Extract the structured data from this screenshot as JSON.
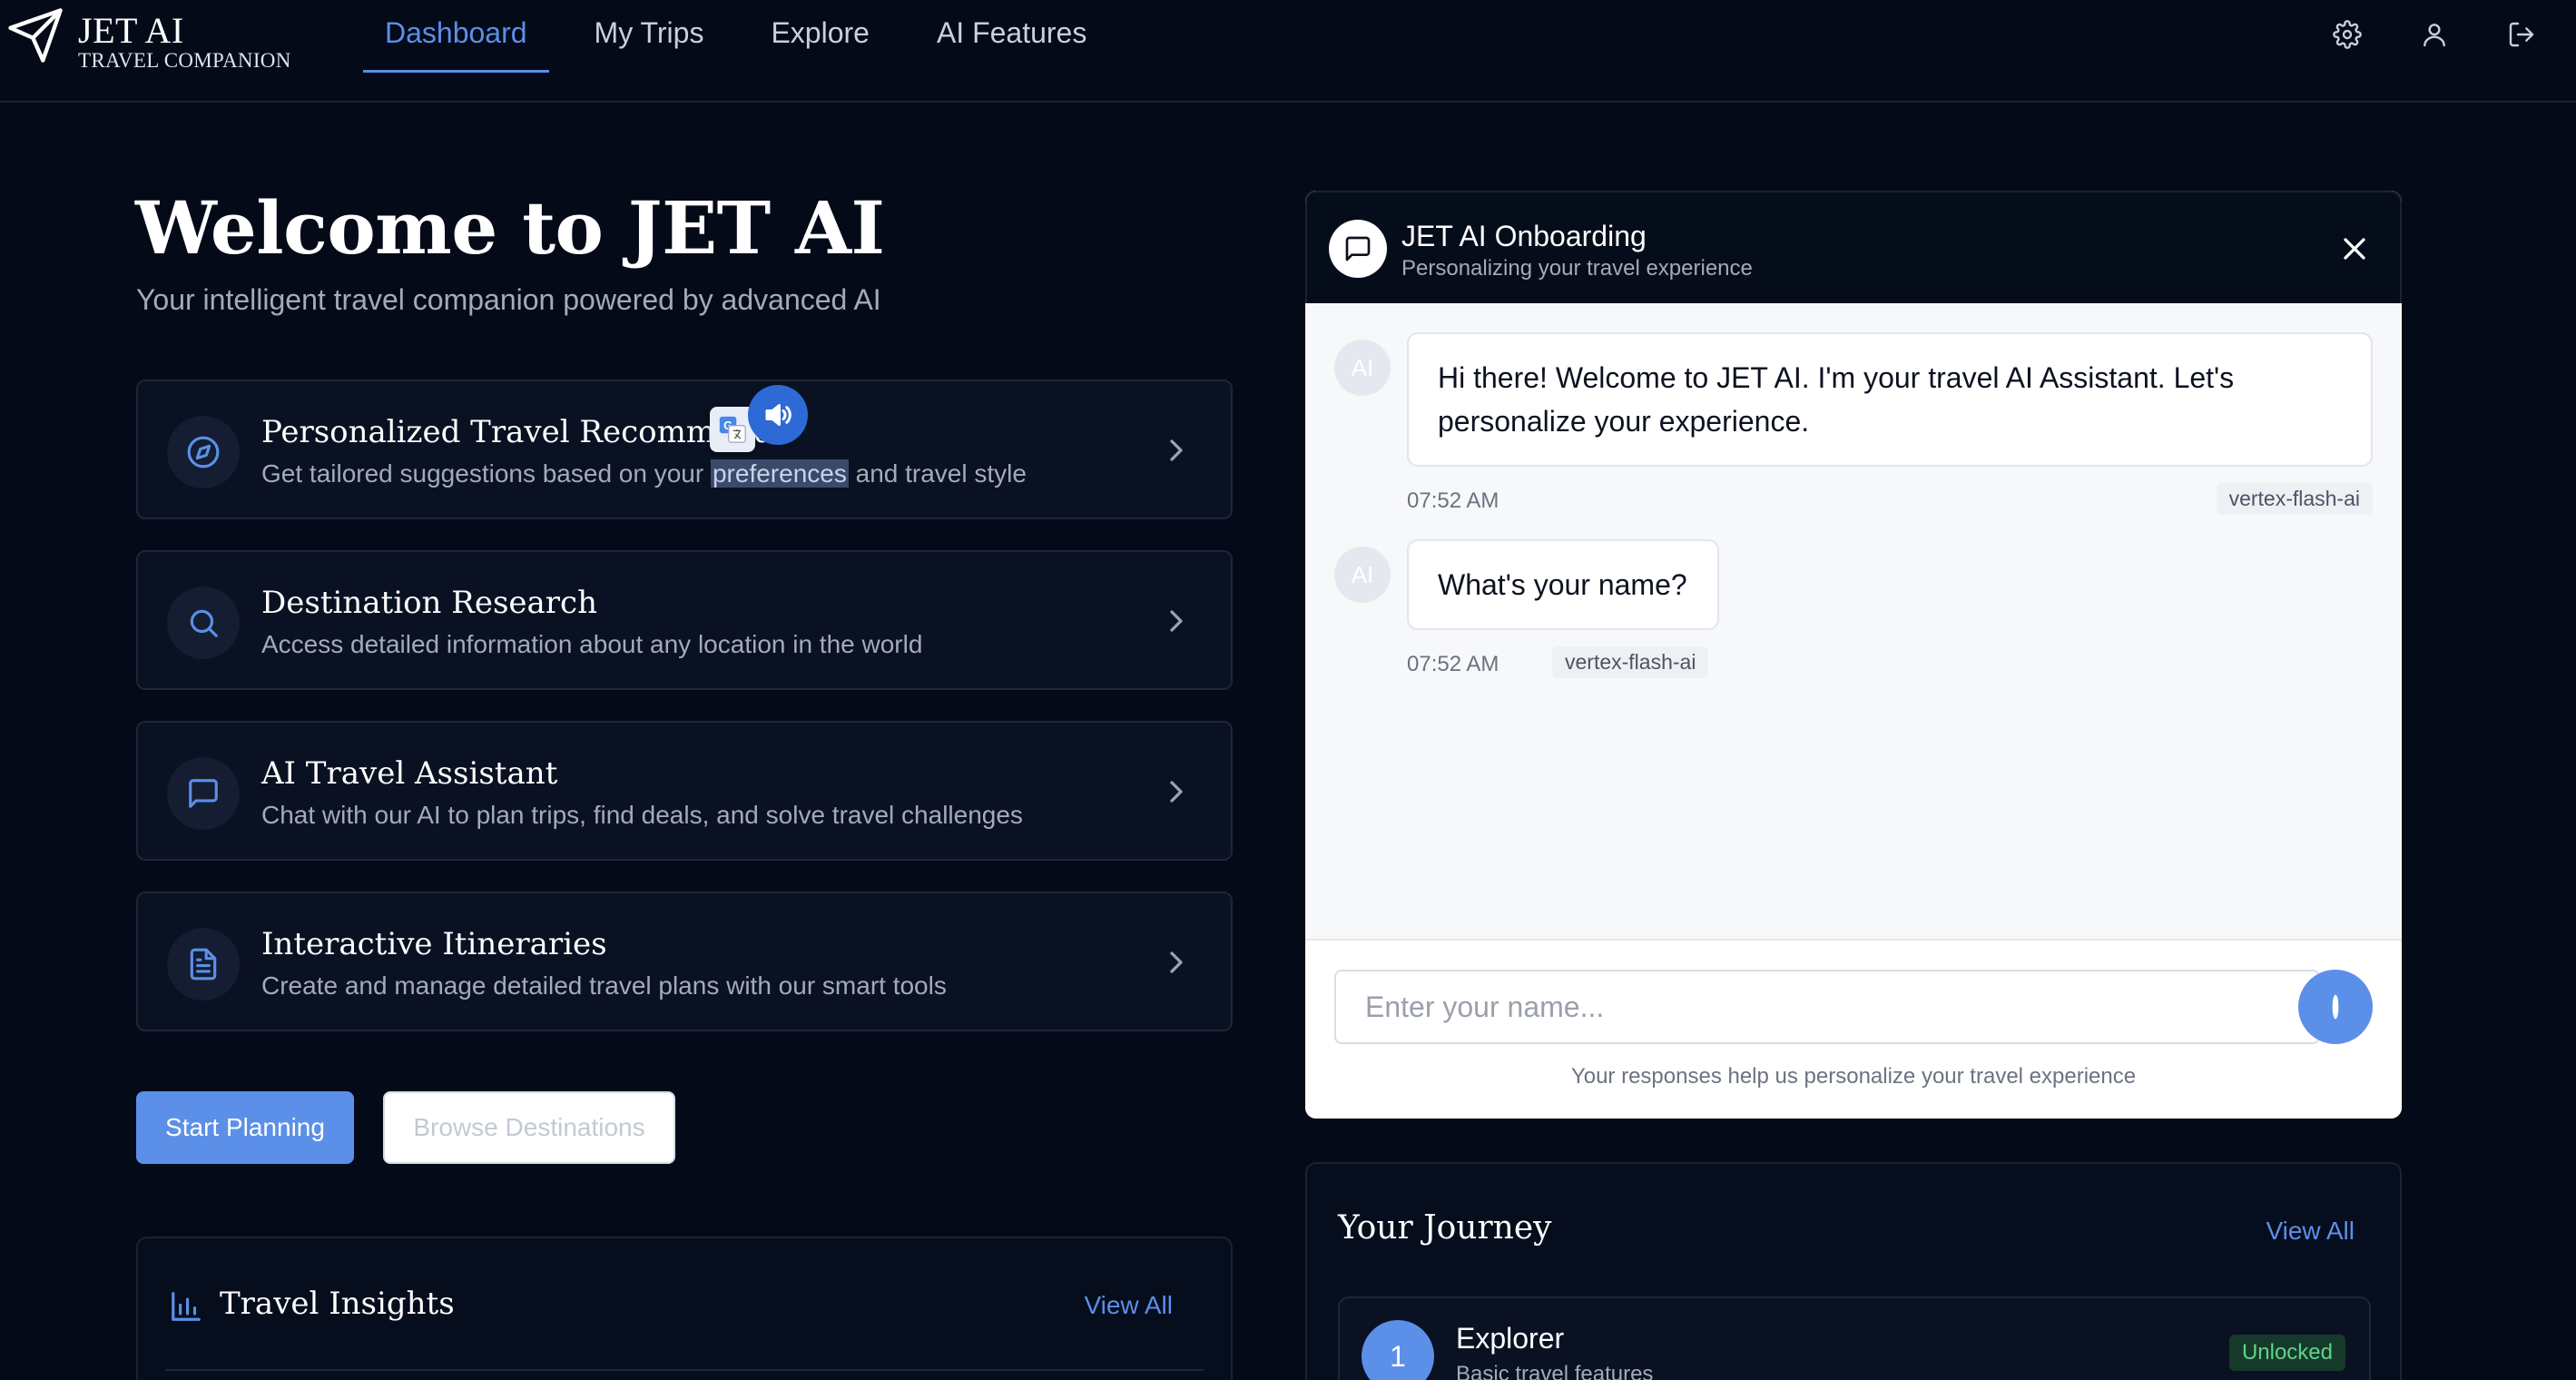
{
  "brand": {
    "name": "JET AI",
    "tagline": "TRAVEL COMPANION"
  },
  "nav": {
    "items": [
      {
        "label": "Dashboard",
        "active": true
      },
      {
        "label": "My Trips",
        "active": false
      },
      {
        "label": "Explore",
        "active": false
      },
      {
        "label": "AI Features",
        "active": false
      }
    ],
    "icons": [
      "gear-icon",
      "user-icon",
      "logout-icon"
    ]
  },
  "hero": {
    "title": "Welcome to JET AI",
    "subtitle": "Your intelligent travel companion powered by advanced AI"
  },
  "features": [
    {
      "icon": "compass-icon",
      "title": "Personalized Travel Recommendations",
      "title_visible": "Personalized Travel Recommenda",
      "desc_before": "Get tailored suggestions based on your ",
      "desc_highlight": "preferences",
      "desc_after": " and travel style"
    },
    {
      "icon": "search-icon",
      "title": "Destination Research",
      "desc": "Access detailed information about any location in the world"
    },
    {
      "icon": "chat-icon",
      "title": "AI Travel Assistant",
      "desc": "Chat with our AI to plan trips, find deals, and solve travel challenges"
    },
    {
      "icon": "document-icon",
      "title": "Interactive Itineraries",
      "desc": "Create and manage detailed travel plans with our smart tools"
    }
  ],
  "actions": {
    "primary": "Start Planning",
    "secondary": "Browse Destinations"
  },
  "insights": {
    "title": "Travel Insights",
    "view_all": "View All"
  },
  "chat": {
    "title": "JET AI Onboarding",
    "subtitle": "Personalizing your travel experience",
    "messages": [
      {
        "avatar": "AI",
        "text": "Hi there! Welcome to JET AI. I'm your travel AI Assistant. Let's personalize your experience.",
        "time": "07:52 AM",
        "model": "vertex-flash-ai"
      },
      {
        "avatar": "AI",
        "text": "What's your name?",
        "time": "07:52 AM",
        "model": "vertex-flash-ai"
      }
    ],
    "input_placeholder": "Enter your name...",
    "note": "Your responses help us personalize your travel experience"
  },
  "journey": {
    "title": "Your Journey",
    "view_all": "View All",
    "level": {
      "number": "1",
      "name": "Explorer",
      "desc": "Basic travel features",
      "badge": "Unlocked"
    }
  },
  "colors": {
    "background": "#040a17",
    "accent": "#5b8fe8",
    "card": "#0a1122",
    "unlocked": "#5fd38a"
  }
}
